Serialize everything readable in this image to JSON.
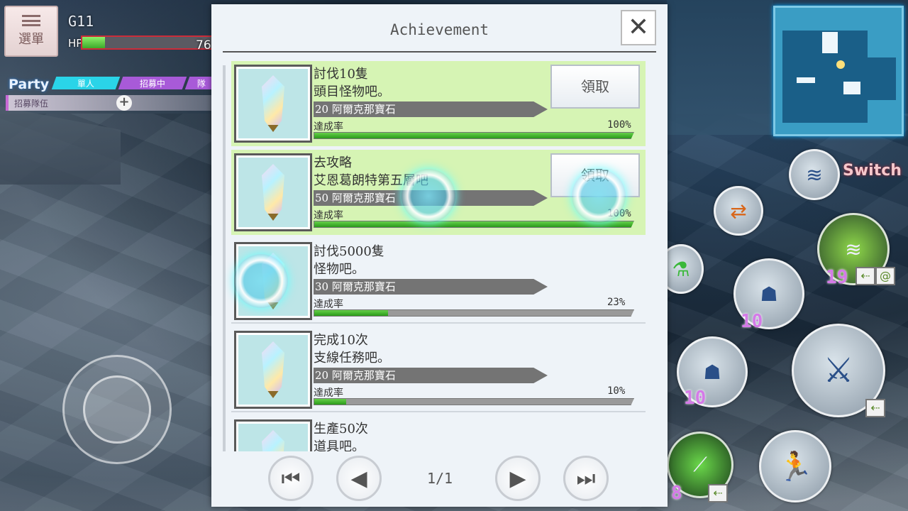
{
  "hud": {
    "menu_label": "選單",
    "player_name": "G11",
    "hp_label": "HP",
    "hp_value": "76",
    "hp_fraction": 0.17,
    "party_label": "Party",
    "party_tabs": [
      "單人",
      "招募中",
      "隊"
    ],
    "recruit_label": "招募隊伍",
    "plus": "+"
  },
  "panel": {
    "title": "Achievement",
    "close": "✕",
    "items": [
      {
        "title": "討伐10隻\n頭目怪物吧。",
        "reward": "20 阿爾克那寶石",
        "rate_label": "達成率",
        "rate_value": "100%",
        "progress": 1.0,
        "completed": true,
        "claim_label": "領取"
      },
      {
        "title": "去攻略\n艾恩葛朗特第五層吧",
        "reward": "50 阿爾克那寶石",
        "rate_label": "達成率",
        "rate_value": "100%",
        "progress": 1.0,
        "completed": true,
        "claim_label": "領取"
      },
      {
        "title": "討伐5000隻\n怪物吧。",
        "reward": "30 阿爾克那寶石",
        "rate_label": "達成率",
        "rate_value": "23%",
        "progress": 0.23,
        "completed": false
      },
      {
        "title": "完成10次\n支線任務吧。",
        "reward": "20 阿爾克那寶石",
        "rate_label": "達成率",
        "rate_value": "10%",
        "progress": 0.1,
        "completed": false
      },
      {
        "title": "生產50次\n道具吧。",
        "reward": "",
        "rate_label": "",
        "rate_value": "",
        "progress": 0,
        "completed": false
      }
    ],
    "page": "1/1"
  },
  "skills": {
    "switch_label": "Switch",
    "counts": [
      "19",
      "10",
      "10",
      "8"
    ]
  },
  "colors": {
    "accent_green": "#d6f4b4",
    "hp_border": "#cc2c3a",
    "minimap": "#3a9dc4"
  }
}
